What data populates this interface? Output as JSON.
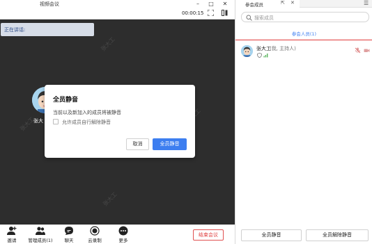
{
  "meeting": {
    "window_title": "视频会议",
    "timer": "00:00:15",
    "speaking_label": "正在讲话:",
    "watermark": "张大工",
    "speaker_name": "张大",
    "dialog": {
      "title": "全员静音",
      "text": "当前以及新加入的成员将被静音",
      "checkbox_label": "允许成员自行解除静音",
      "checkbox_checked": false,
      "cancel_label": "取消",
      "confirm_label": "全员静音"
    },
    "toolbar": [
      {
        "name": "invite",
        "label": "邀请"
      },
      {
        "name": "manage-members",
        "label": "管理成员(1)"
      },
      {
        "name": "chat",
        "label": "聊天"
      },
      {
        "name": "cloud-record",
        "label": "云录制"
      },
      {
        "name": "more",
        "label": "更多"
      }
    ],
    "end_button": "结束会议"
  },
  "panel": {
    "tab_label": "参会成员",
    "search_placeholder": "搜索成员",
    "subtab_label": "参会人员(1)",
    "member": {
      "name": "张大工",
      "role": "(我, 主持人)"
    },
    "mute_all_button": "全员静音",
    "unmute_all_button": "全员解除静音"
  },
  "colors": {
    "accent": "#3d7ef0",
    "end_red": "#e04040",
    "stage_bg": "#2d2d2d"
  }
}
